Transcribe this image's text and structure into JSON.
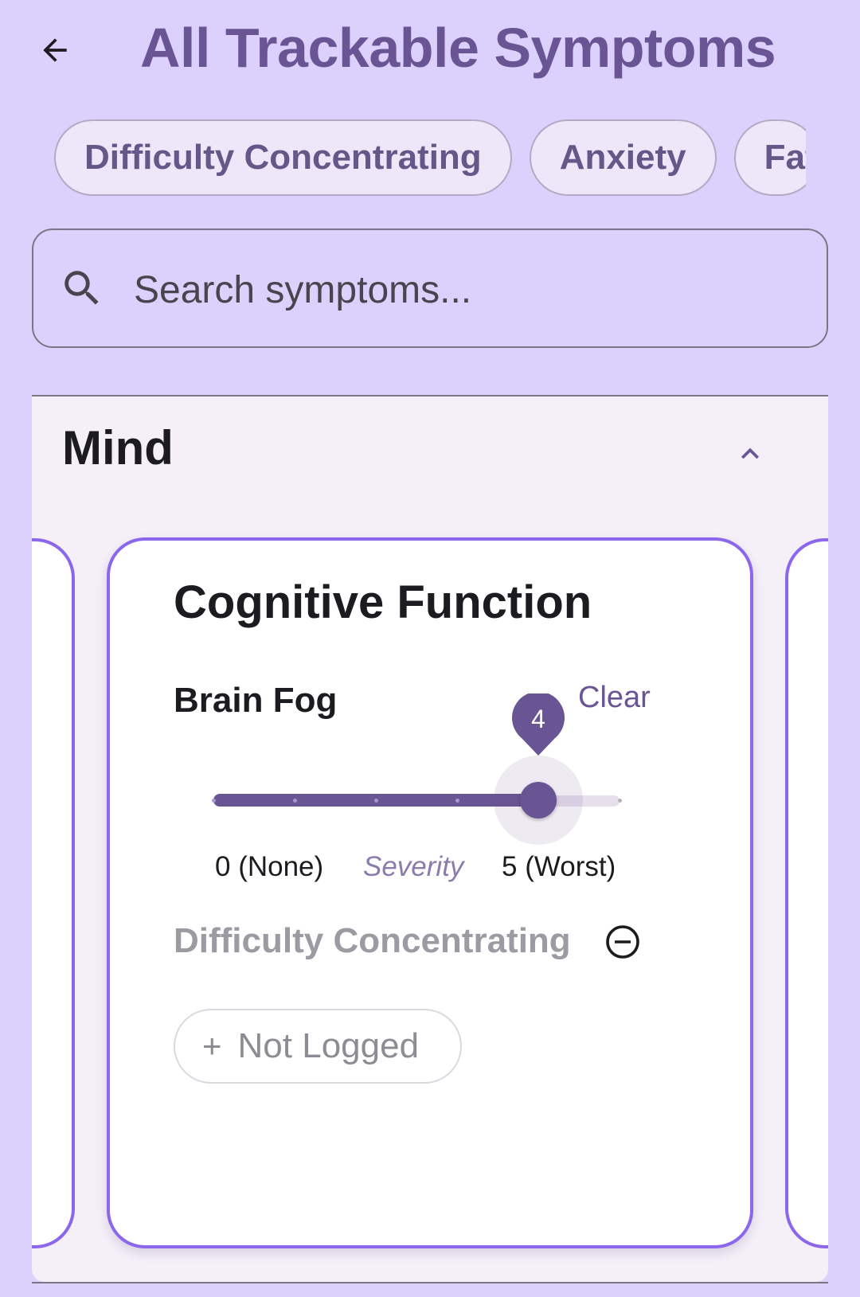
{
  "header": {
    "title": "All Trackable Symptoms",
    "back_icon": "arrow-left-icon"
  },
  "chips": [
    {
      "label": "Difficulty Concentrating"
    },
    {
      "label": "Anxiety"
    },
    {
      "label": "Fat"
    }
  ],
  "search": {
    "placeholder": "Search symptoms...",
    "value": "",
    "icon": "search-icon"
  },
  "section": {
    "title": "Mind",
    "expanded": true,
    "toggle_icon": "chevron-up-icon"
  },
  "card": {
    "title": "Cognitive Function",
    "symptoms": [
      {
        "name": "Brain Fog",
        "clear_label": "Clear",
        "severity": {
          "value": 4,
          "min": 0,
          "max": 5,
          "min_label": "0 (None)",
          "max_label": "5 (Worst)",
          "caption": "Severity"
        }
      },
      {
        "name": "Difficulty Concentrating",
        "remove_icon": "minus-circle-icon",
        "log_button": {
          "icon": "plus-icon",
          "plus_glyph": "+",
          "label": "Not Logged"
        }
      }
    ]
  },
  "colors": {
    "background": "#dcd1fd",
    "accent": "#6a5594",
    "card_border": "#8c67eb",
    "chip_bg": "#eee6f9",
    "section_bg": "#f5f0f8"
  }
}
